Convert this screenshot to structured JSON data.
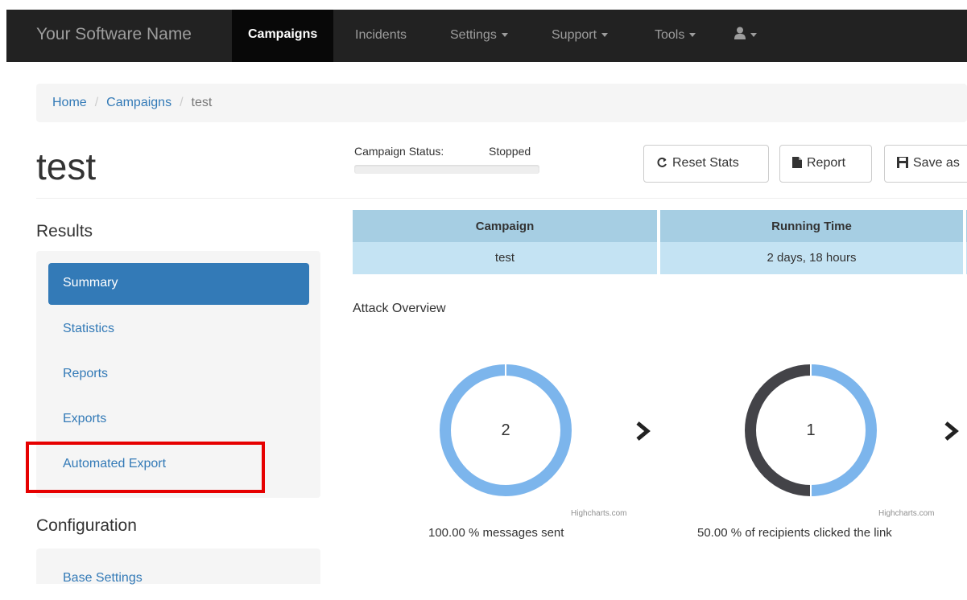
{
  "navbar": {
    "brand": "Your Software Name",
    "items": [
      {
        "label": "Campaigns",
        "active": true
      },
      {
        "label": "Incidents"
      },
      {
        "label": "Settings"
      },
      {
        "label": "Support"
      },
      {
        "label": "Tools"
      }
    ],
    "user_icon": "user-icon"
  },
  "breadcrumb": {
    "items": [
      "Home",
      "Campaigns",
      "test"
    ],
    "separator": "/"
  },
  "page": {
    "title": "test"
  },
  "campaign_status": {
    "label": "Campaign Status:",
    "value": "Stopped"
  },
  "actions": {
    "reset_stats": "Reset Stats",
    "report": "Report",
    "save_as": "Save as"
  },
  "results": {
    "title": "Results",
    "items": [
      "Summary",
      "Statistics",
      "Reports",
      "Exports",
      "Automated Export"
    ],
    "active": "Summary"
  },
  "configuration": {
    "title": "Configuration",
    "items": [
      "Base Settings"
    ]
  },
  "stats_table": {
    "headers": [
      "Campaign",
      "Running Time"
    ],
    "values": [
      "test",
      "2 days, 18 hours"
    ]
  },
  "overview": {
    "title": "Attack Overview",
    "charts": [
      {
        "value": "2",
        "caption": "100.00 % messages sent",
        "credit": "Highcharts.com",
        "fraction": 1.0
      },
      {
        "value": "1",
        "caption": "50.00 % of recipients clicked the link",
        "credit": "Highcharts.com",
        "fraction": 0.5
      }
    ]
  },
  "colors": {
    "navbar_bg": "#222222",
    "link": "#337ab7",
    "active_bg": "#337ab7",
    "highlight": "#e60000",
    "donut_blue": "#7cb5ec",
    "donut_dark": "#434348",
    "table_header": "#a6cee3",
    "table_cell": "#c4e3f3"
  }
}
